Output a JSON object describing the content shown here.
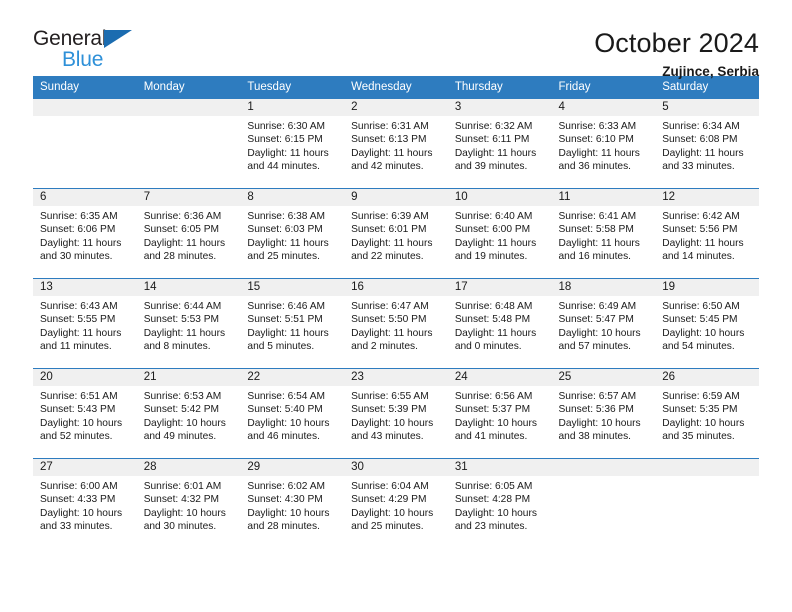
{
  "brand": {
    "name_top": "General",
    "name_bottom": "Blue",
    "accent_blue": "#2e7cbf",
    "logo_blue": "#2e90d8"
  },
  "header": {
    "title": "October 2024",
    "subtitle": "Zujince, Serbia"
  },
  "weekday_headers": [
    "Sunday",
    "Monday",
    "Tuesday",
    "Wednesday",
    "Thursday",
    "Friday",
    "Saturday"
  ],
  "labels": {
    "sunrise_prefix": "Sunrise:",
    "sunset_prefix": "Sunset:",
    "daylight_prefix": "Daylight:"
  },
  "weeks": [
    [
      {
        "day": "",
        "line1": "",
        "line2": "",
        "line3": "",
        "line4": ""
      },
      {
        "day": "",
        "line1": "",
        "line2": "",
        "line3": "",
        "line4": ""
      },
      {
        "day": "1",
        "line1": "Sunrise: 6:30 AM",
        "line2": "Sunset: 6:15 PM",
        "line3": "Daylight: 11 hours",
        "line4": "and 44 minutes."
      },
      {
        "day": "2",
        "line1": "Sunrise: 6:31 AM",
        "line2": "Sunset: 6:13 PM",
        "line3": "Daylight: 11 hours",
        "line4": "and 42 minutes."
      },
      {
        "day": "3",
        "line1": "Sunrise: 6:32 AM",
        "line2": "Sunset: 6:11 PM",
        "line3": "Daylight: 11 hours",
        "line4": "and 39 minutes."
      },
      {
        "day": "4",
        "line1": "Sunrise: 6:33 AM",
        "line2": "Sunset: 6:10 PM",
        "line3": "Daylight: 11 hours",
        "line4": "and 36 minutes."
      },
      {
        "day": "5",
        "line1": "Sunrise: 6:34 AM",
        "line2": "Sunset: 6:08 PM",
        "line3": "Daylight: 11 hours",
        "line4": "and 33 minutes."
      }
    ],
    [
      {
        "day": "6",
        "line1": "Sunrise: 6:35 AM",
        "line2": "Sunset: 6:06 PM",
        "line3": "Daylight: 11 hours",
        "line4": "and 30 minutes."
      },
      {
        "day": "7",
        "line1": "Sunrise: 6:36 AM",
        "line2": "Sunset: 6:05 PM",
        "line3": "Daylight: 11 hours",
        "line4": "and 28 minutes."
      },
      {
        "day": "8",
        "line1": "Sunrise: 6:38 AM",
        "line2": "Sunset: 6:03 PM",
        "line3": "Daylight: 11 hours",
        "line4": "and 25 minutes."
      },
      {
        "day": "9",
        "line1": "Sunrise: 6:39 AM",
        "line2": "Sunset: 6:01 PM",
        "line3": "Daylight: 11 hours",
        "line4": "and 22 minutes."
      },
      {
        "day": "10",
        "line1": "Sunrise: 6:40 AM",
        "line2": "Sunset: 6:00 PM",
        "line3": "Daylight: 11 hours",
        "line4": "and 19 minutes."
      },
      {
        "day": "11",
        "line1": "Sunrise: 6:41 AM",
        "line2": "Sunset: 5:58 PM",
        "line3": "Daylight: 11 hours",
        "line4": "and 16 minutes."
      },
      {
        "day": "12",
        "line1": "Sunrise: 6:42 AM",
        "line2": "Sunset: 5:56 PM",
        "line3": "Daylight: 11 hours",
        "line4": "and 14 minutes."
      }
    ],
    [
      {
        "day": "13",
        "line1": "Sunrise: 6:43 AM",
        "line2": "Sunset: 5:55 PM",
        "line3": "Daylight: 11 hours",
        "line4": "and 11 minutes."
      },
      {
        "day": "14",
        "line1": "Sunrise: 6:44 AM",
        "line2": "Sunset: 5:53 PM",
        "line3": "Daylight: 11 hours",
        "line4": "and 8 minutes."
      },
      {
        "day": "15",
        "line1": "Sunrise: 6:46 AM",
        "line2": "Sunset: 5:51 PM",
        "line3": "Daylight: 11 hours",
        "line4": "and 5 minutes."
      },
      {
        "day": "16",
        "line1": "Sunrise: 6:47 AM",
        "line2": "Sunset: 5:50 PM",
        "line3": "Daylight: 11 hours",
        "line4": "and 2 minutes."
      },
      {
        "day": "17",
        "line1": "Sunrise: 6:48 AM",
        "line2": "Sunset: 5:48 PM",
        "line3": "Daylight: 11 hours",
        "line4": "and 0 minutes."
      },
      {
        "day": "18",
        "line1": "Sunrise: 6:49 AM",
        "line2": "Sunset: 5:47 PM",
        "line3": "Daylight: 10 hours",
        "line4": "and 57 minutes."
      },
      {
        "day": "19",
        "line1": "Sunrise: 6:50 AM",
        "line2": "Sunset: 5:45 PM",
        "line3": "Daylight: 10 hours",
        "line4": "and 54 minutes."
      }
    ],
    [
      {
        "day": "20",
        "line1": "Sunrise: 6:51 AM",
        "line2": "Sunset: 5:43 PM",
        "line3": "Daylight: 10 hours",
        "line4": "and 52 minutes."
      },
      {
        "day": "21",
        "line1": "Sunrise: 6:53 AM",
        "line2": "Sunset: 5:42 PM",
        "line3": "Daylight: 10 hours",
        "line4": "and 49 minutes."
      },
      {
        "day": "22",
        "line1": "Sunrise: 6:54 AM",
        "line2": "Sunset: 5:40 PM",
        "line3": "Daylight: 10 hours",
        "line4": "and 46 minutes."
      },
      {
        "day": "23",
        "line1": "Sunrise: 6:55 AM",
        "line2": "Sunset: 5:39 PM",
        "line3": "Daylight: 10 hours",
        "line4": "and 43 minutes."
      },
      {
        "day": "24",
        "line1": "Sunrise: 6:56 AM",
        "line2": "Sunset: 5:37 PM",
        "line3": "Daylight: 10 hours",
        "line4": "and 41 minutes."
      },
      {
        "day": "25",
        "line1": "Sunrise: 6:57 AM",
        "line2": "Sunset: 5:36 PM",
        "line3": "Daylight: 10 hours",
        "line4": "and 38 minutes."
      },
      {
        "day": "26",
        "line1": "Sunrise: 6:59 AM",
        "line2": "Sunset: 5:35 PM",
        "line3": "Daylight: 10 hours",
        "line4": "and 35 minutes."
      }
    ],
    [
      {
        "day": "27",
        "line1": "Sunrise: 6:00 AM",
        "line2": "Sunset: 4:33 PM",
        "line3": "Daylight: 10 hours",
        "line4": "and 33 minutes."
      },
      {
        "day": "28",
        "line1": "Sunrise: 6:01 AM",
        "line2": "Sunset: 4:32 PM",
        "line3": "Daylight: 10 hours",
        "line4": "and 30 minutes."
      },
      {
        "day": "29",
        "line1": "Sunrise: 6:02 AM",
        "line2": "Sunset: 4:30 PM",
        "line3": "Daylight: 10 hours",
        "line4": "and 28 minutes."
      },
      {
        "day": "30",
        "line1": "Sunrise: 6:04 AM",
        "line2": "Sunset: 4:29 PM",
        "line3": "Daylight: 10 hours",
        "line4": "and 25 minutes."
      },
      {
        "day": "31",
        "line1": "Sunrise: 6:05 AM",
        "line2": "Sunset: 4:28 PM",
        "line3": "Daylight: 10 hours",
        "line4": "and 23 minutes."
      },
      {
        "day": "",
        "line1": "",
        "line2": "",
        "line3": "",
        "line4": ""
      },
      {
        "day": "",
        "line1": "",
        "line2": "",
        "line3": "",
        "line4": ""
      }
    ]
  ]
}
